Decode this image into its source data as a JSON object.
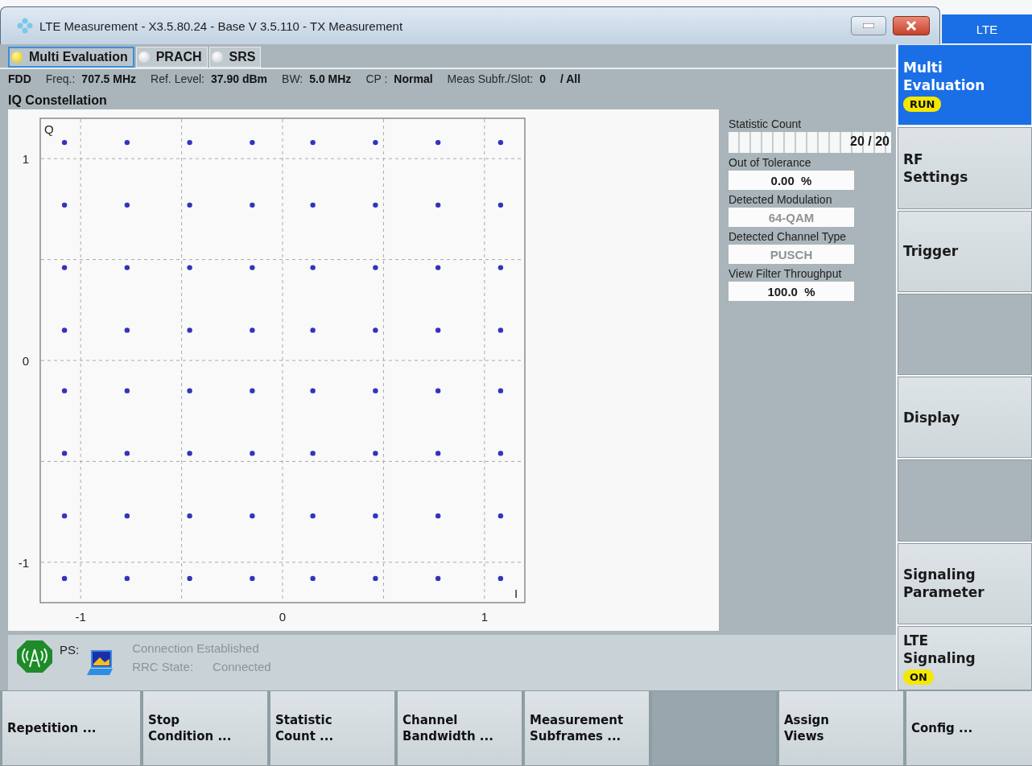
{
  "window": {
    "title": "LTE Measurement  - X3.5.80.24 - Base V 3.5.110 - TX Measurement"
  },
  "tabs": [
    {
      "label": "Multi Evaluation",
      "selected": true
    },
    {
      "label": "PRACH",
      "selected": false
    },
    {
      "label": "SRS",
      "selected": false
    }
  ],
  "info_bar": [
    {
      "value": "FDD"
    },
    {
      "label": "Freq.:",
      "value": "707.5 MHz"
    },
    {
      "label": "Ref. Level:",
      "value": "37.90 dBm"
    },
    {
      "label": "BW:",
      "value": "5.0 MHz"
    },
    {
      "label": "CP :",
      "value": "Normal"
    },
    {
      "label": "Meas Subfr./Slot:",
      "value": "0"
    },
    {
      "value": "/ All"
    }
  ],
  "view": {
    "title": "IQ Constellation",
    "x_axis_label": "I",
    "y_axis_label": "Q",
    "chart_data": {
      "type": "scatter",
      "grid": true,
      "xlim": [
        -1.2,
        1.2
      ],
      "ylim": [
        -1.2,
        1.2
      ],
      "xticks": [
        -1,
        0,
        1
      ],
      "yticks": [
        -1,
        0,
        1
      ],
      "x": [
        -1.08,
        -0.77,
        -0.46,
        -0.15,
        0.15,
        0.46,
        0.77,
        1.08,
        -1.08,
        -0.77,
        -0.46,
        -0.15,
        0.15,
        0.46,
        0.77,
        1.08,
        -1.08,
        -0.77,
        -0.46,
        -0.15,
        0.15,
        0.46,
        0.77,
        1.08,
        -1.08,
        -0.77,
        -0.46,
        -0.15,
        0.15,
        0.46,
        0.77,
        1.08,
        -1.08,
        -0.77,
        -0.46,
        -0.15,
        0.15,
        0.46,
        0.77,
        1.08,
        -1.08,
        -0.77,
        -0.46,
        -0.15,
        0.15,
        0.46,
        0.77,
        1.08,
        -1.08,
        -0.77,
        -0.46,
        -0.15,
        0.15,
        0.46,
        0.77,
        1.08,
        -1.08,
        -0.77,
        -0.46,
        -0.15,
        0.15,
        0.46,
        0.77,
        1.08
      ],
      "series": [
        {
          "color": "#3333bb",
          "values": [
            1.08,
            1.08,
            1.08,
            1.08,
            1.08,
            1.08,
            1.08,
            1.08,
            0.77,
            0.77,
            0.77,
            0.77,
            0.77,
            0.77,
            0.77,
            0.77,
            0.46,
            0.46,
            0.46,
            0.46,
            0.46,
            0.46,
            0.46,
            0.46,
            0.15,
            0.15,
            0.15,
            0.15,
            0.15,
            0.15,
            0.15,
            0.15,
            -0.15,
            -0.15,
            -0.15,
            -0.15,
            -0.15,
            -0.15,
            -0.15,
            -0.15,
            -0.46,
            -0.46,
            -0.46,
            -0.46,
            -0.46,
            -0.46,
            -0.46,
            -0.46,
            -0.77,
            -0.77,
            -0.77,
            -0.77,
            -0.77,
            -0.77,
            -0.77,
            -0.77,
            -1.08,
            -1.08,
            -1.08,
            -1.08,
            -1.08,
            -1.08,
            -1.08,
            -1.08
          ]
        }
      ]
    }
  },
  "results": [
    {
      "kind": "progress",
      "label": "Statistic Count",
      "level": 1,
      "value": "20 / 20"
    },
    {
      "kind": "field",
      "label": "Out of Tolerance",
      "value": "0.00  %",
      "dimmed": false
    },
    {
      "kind": "field",
      "label": "Detected Modulation",
      "value": "64-QAM",
      "dimmed": true
    },
    {
      "kind": "field",
      "label": "Detected Channel Type",
      "value": "PUSCH",
      "dimmed": true
    },
    {
      "kind": "field",
      "label": "View Filter Throughput",
      "value": "100.0  %",
      "dimmed": false
    }
  ],
  "status": {
    "label": "PS:",
    "connection": "Connection Established",
    "rrc_label": "RRC State:",
    "rrc_value": "Connected"
  },
  "softkeys": {
    "header": "LTE",
    "items": [
      {
        "kind": "button",
        "label": "Multi\nEvaluation",
        "badge": "RUN",
        "selected": true
      },
      {
        "kind": "button",
        "label": "RF\nSettings",
        "selected": false
      },
      {
        "kind": "button",
        "label": "Trigger",
        "selected": false
      },
      {
        "kind": "blank",
        "selected": false
      },
      {
        "kind": "button",
        "label": "Display",
        "selected": false
      },
      {
        "kind": "blank",
        "selected": false
      },
      {
        "kind": "button",
        "label": "Signaling\nParameter",
        "selected": false
      },
      {
        "kind": "button",
        "label": "LTE\nSignaling",
        "badge": "ON",
        "selected": false
      }
    ]
  },
  "hotkeys": [
    {
      "kind": "button",
      "label": "Repetition ..."
    },
    {
      "kind": "button",
      "label": "Stop\nCondition ..."
    },
    {
      "kind": "button",
      "label": "Statistic\nCount ..."
    },
    {
      "kind": "button",
      "label": "Channel\nBandwidth ..."
    },
    {
      "kind": "button",
      "label": "Measurement\nSubframes ..."
    },
    {
      "kind": "blank"
    },
    {
      "kind": "button",
      "label": "Assign\nViews"
    },
    {
      "kind": "button",
      "label": "Config ..."
    }
  ]
}
